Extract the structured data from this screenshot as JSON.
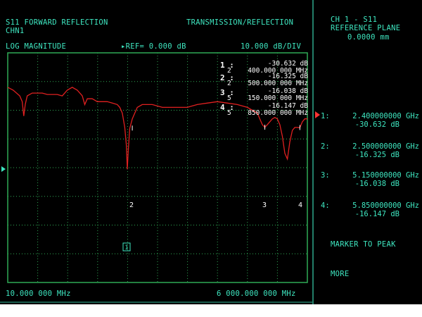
{
  "header": {
    "title": "S11 FORWARD REFLECTION",
    "mode": "TRANSMISSION/REFLECTION",
    "channel": "CHN1",
    "format": "LOG MAGNITUDE",
    "ref": "REF= 0.000 dB",
    "scale": "10.000 dB/DIV"
  },
  "footer": {
    "start": "10.000 000 MHz",
    "stop": "6 000.000 000 MHz"
  },
  "markers": [
    {
      "num": "1 :",
      "value": "-30.632 dB",
      "ch": "2",
      "freq": "400.000 000 MHz"
    },
    {
      "num": "2 :",
      "value": "-16.325 dB",
      "ch": "2",
      "freq": "500.000 000 MHz"
    },
    {
      "num": "3 :",
      "value": "-16.038 dB",
      "ch": "5",
      "freq": "150.000 000 MHz"
    },
    {
      "num": "4 :",
      "value": "-16.147 dB",
      "ch": "5",
      "freq": "850.000 000 MHz"
    }
  ],
  "sidebar": {
    "title_line1": "CH 1 - S11",
    "title_line2": "REFERENCE PLANE",
    "title_line3": "0.0000 mm",
    "entries": [
      {
        "label": "1:",
        "freq": "2.400000000 GHz",
        "value": "-30.632 dB"
      },
      {
        "label": "2:",
        "freq": "2.500000000 GHz",
        "value": "-16.325 dB"
      },
      {
        "label": "3:",
        "freq": "5.150000000 GHz",
        "value": "-16.038 dB"
      },
      {
        "label": "4:",
        "freq": "5.850000000 GHz",
        "value": "-16.147 dB"
      }
    ],
    "marker_to_peak": "MARKER TO PEAK",
    "more": "MORE"
  },
  "trace_labels": [
    "1",
    "2",
    "3",
    "4"
  ],
  "colors": {
    "text": "#3ee6c0",
    "trace": "#e02020",
    "grid": "#2faa55",
    "marker_text": "#ffffff",
    "active_marker": "#ff3333",
    "background": "#000000"
  },
  "chart_data": {
    "type": "line",
    "xlim": [
      10,
      6000
    ],
    "ylim": [
      -70,
      10
    ],
    "x_unit": "MHz",
    "y_unit": "dB",
    "grid": true,
    "series": [
      {
        "x": [
          10,
          120,
          250,
          300,
          330,
          360,
          400,
          500,
          600,
          700,
          800,
          900,
          1000,
          1100,
          1200,
          1300,
          1400,
          1500,
          1550,
          1600,
          1650,
          1700,
          1750,
          1800,
          1900,
          2000,
          2100,
          2200,
          2250,
          2300,
          2350,
          2380,
          2400,
          2420,
          2450,
          2500,
          2550,
          2600,
          2700,
          2800,
          2900,
          3000,
          3100,
          3200,
          3400,
          3600,
          3800,
          4000,
          4200,
          4400,
          4600,
          4700,
          4800,
          4900,
          5000,
          5050,
          5100,
          5150,
          5200,
          5250,
          5300,
          5350,
          5400,
          5450,
          5500,
          5550,
          5600,
          5650,
          5700,
          5750,
          5800,
          5850,
          5900,
          5950,
          6000
        ],
        "y": [
          -2,
          -3,
          -5,
          -7,
          -12,
          -8,
          -5,
          -4,
          -4,
          -4,
          -4.5,
          -4.5,
          -4.5,
          -5,
          -3,
          -2,
          -3,
          -5,
          -8,
          -6,
          -6,
          -6,
          -6.5,
          -7,
          -7,
          -7,
          -7.5,
          -8,
          -9,
          -11,
          -16,
          -22,
          -30.6,
          -24,
          -16.3,
          -13,
          -11,
          -9,
          -8,
          -8,
          -8,
          -8.5,
          -9,
          -9,
          -9,
          -9,
          -8,
          -7.5,
          -7,
          -7.5,
          -8,
          -8.5,
          -9,
          -10,
          -11,
          -13,
          -15,
          -16,
          -15,
          -14,
          -13,
          -12.5,
          -13,
          -15,
          -19,
          -25,
          -27,
          -21,
          -17,
          -16,
          -16,
          -16.1,
          -14,
          -13,
          -13
        ]
      }
    ]
  }
}
